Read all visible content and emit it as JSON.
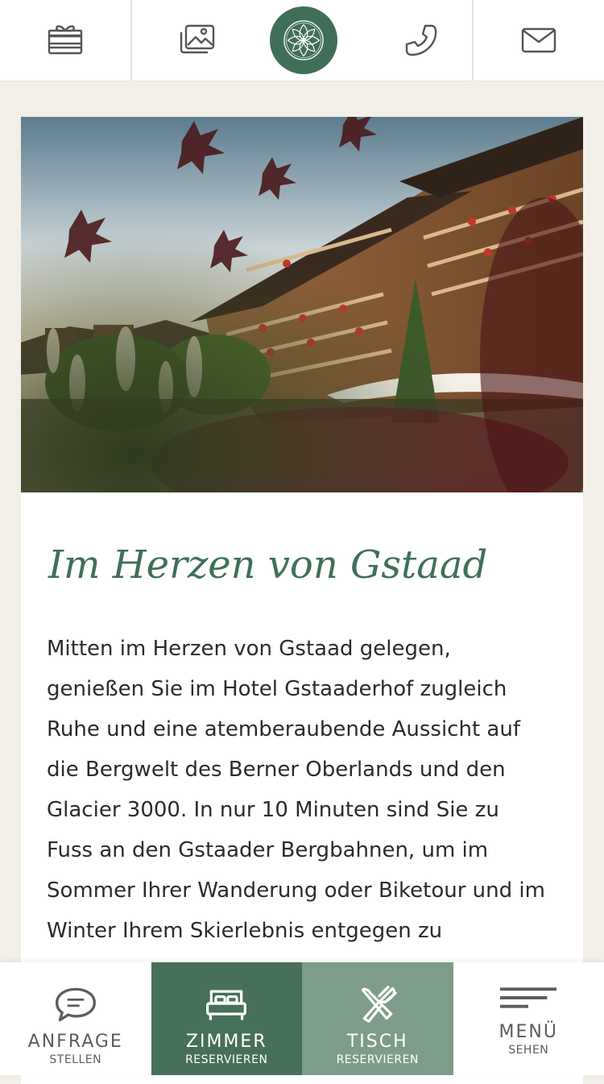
{
  "header": {
    "icons": [
      "gift-icon",
      "gallery-icon",
      "logo",
      "phone-icon",
      "mail-icon"
    ]
  },
  "content": {
    "title": "Im Herzen von Gstaad",
    "lines": [
      "Mitten im Herzen von Gstaad gelegen,",
      "genießen Sie im Hotel Gstaaderhof zugleich",
      "Ruhe und eine atemberaubende Aussicht auf",
      "die Bergwelt des Berner Oberlands und den",
      "Glacier 3000. In nur 10 Minuten sind Sie zu",
      "Fuss an den Gstaader Bergbahnen, um im",
      "Sommer Ihrer Wanderung oder Biketour und im",
      "Winter Ihrem Skierlebnis entgegen zu"
    ]
  },
  "bottom_nav": {
    "anfrage": {
      "line1": "ANFRAGE",
      "line2": "STELLEN"
    },
    "zimmer": {
      "line1": "ZIMMER",
      "line2": "RESERVIEREN"
    },
    "tisch": {
      "line1": "TISCH",
      "line2": "RESERVIEREN"
    },
    "menu": {
      "line1": "MENÜ",
      "line2": "SEHEN"
    }
  },
  "colors": {
    "brand_green": "#3f6f58",
    "zimmer_bg": "#46705a",
    "tisch_bg": "#7e9c8a",
    "page_bg": "#f1efe8"
  }
}
